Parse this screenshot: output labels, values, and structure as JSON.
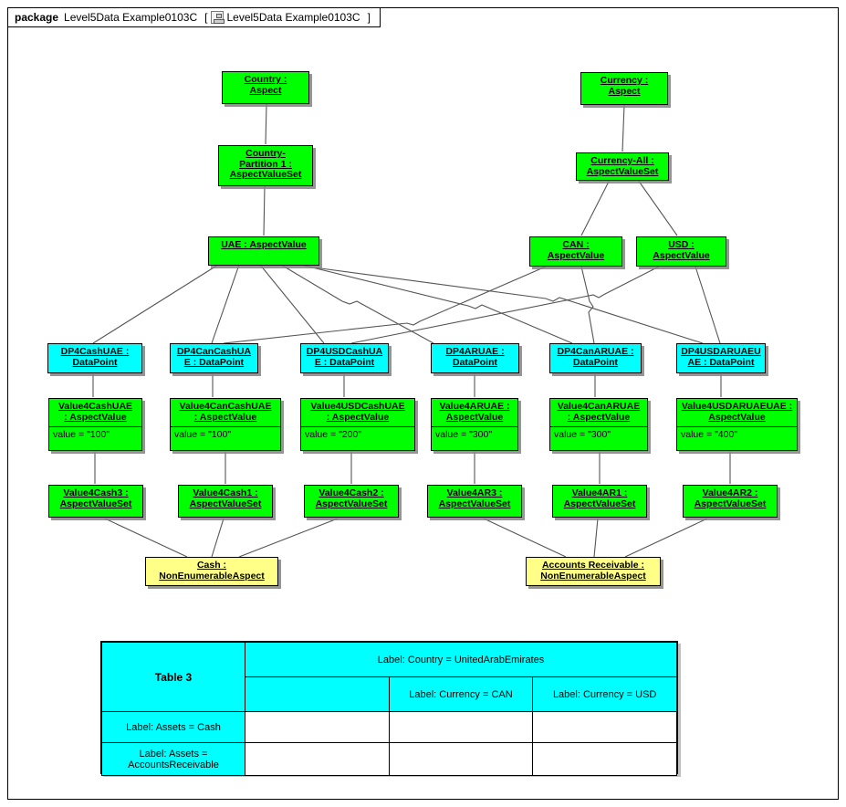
{
  "package": {
    "keyword": "package",
    "title": "Level5Data Example0103C",
    "bracket_open": "[",
    "icon": "class-diagram-icon",
    "diagram_name": "Level5Data Example0103C",
    "bracket_close": "]"
  },
  "colors": {
    "aspect_green": "#00FF00",
    "datapoint_cyan": "#00FFFF",
    "nonenumerable_yellow": "#FFFF88",
    "table_header_cyan": "#00FFFF",
    "border": "#000000",
    "edge": "#555555"
  },
  "nodes": [
    {
      "id": "country",
      "label": "Country :\nAspect",
      "kind": "green"
    },
    {
      "id": "currency",
      "label": "Currency :\nAspect",
      "kind": "green"
    },
    {
      "id": "countryPart1",
      "label": "Country-\nPartition 1 :\nAspectValueSet",
      "kind": "green"
    },
    {
      "id": "currencyAll",
      "label": "Currency-All :\nAspectValueSet",
      "kind": "green"
    },
    {
      "id": "uae",
      "label": "UAE : AspectValue",
      "kind": "green"
    },
    {
      "id": "can",
      "label": "CAN :\nAspectValue",
      "kind": "green"
    },
    {
      "id": "usd",
      "label": "USD :\nAspectValue",
      "kind": "green"
    },
    {
      "id": "dp4CashUAE",
      "label": "DP4CashUAE :\nDataPoint",
      "kind": "cyan"
    },
    {
      "id": "dp4CanCashUAE",
      "label": "DP4CanCashUA\nE : DataPoint",
      "kind": "cyan"
    },
    {
      "id": "dp4UsdCashUAE",
      "label": "DP4USDCashUA\nE : DataPoint",
      "kind": "cyan"
    },
    {
      "id": "dp4ARUAE",
      "label": "DP4ARUAE :\nDataPoint",
      "kind": "cyan"
    },
    {
      "id": "dp4CanARUAE",
      "label": "DP4CanARUAE :\nDataPoint",
      "kind": "cyan"
    },
    {
      "id": "dp4UsdARUAEUAE",
      "label": "DP4USDARUAEU\nAE : DataPoint",
      "kind": "cyan"
    },
    {
      "id": "v4CashUAE",
      "label": "Value4CashUAE\n: AspectValue",
      "kind": "green",
      "attr": "value = \"100\""
    },
    {
      "id": "v4CanCashUAE",
      "label": "Value4CanCashUAE\n: AspectValue",
      "kind": "green",
      "attr": "value = \"100\""
    },
    {
      "id": "v4UsdCashUAE",
      "label": "Value4USDCashUAE\n: AspectValue",
      "kind": "green",
      "attr": "value = \"200\""
    },
    {
      "id": "v4ARUAE",
      "label": "Value4ARUAE :\nAspectValue",
      "kind": "green",
      "attr": "value = \"300\""
    },
    {
      "id": "v4CanARUAE",
      "label": "Value4CanARUAE\n: AspectValue",
      "kind": "green",
      "attr": "value = \"300\""
    },
    {
      "id": "v4UsdARUAEUAE",
      "label": "Value4USDARUAEUAE :\nAspectValue",
      "kind": "green",
      "attr": "value = \"400\""
    },
    {
      "id": "v4Cash3",
      "label": "Value4Cash3 :\nAspectValueSet",
      "kind": "green"
    },
    {
      "id": "v4Cash1",
      "label": "Value4Cash1 :\nAspectValueSet",
      "kind": "green"
    },
    {
      "id": "v4Cash2",
      "label": "Value4Cash2 :\nAspectValueSet",
      "kind": "green"
    },
    {
      "id": "v4AR3",
      "label": "Value4AR3 :\nAspectValueSet",
      "kind": "green"
    },
    {
      "id": "v4AR1",
      "label": "Value4AR1 :\nAspectValueSet",
      "kind": "green"
    },
    {
      "id": "v4AR2",
      "label": "Value4AR2 :\nAspectValueSet",
      "kind": "green"
    },
    {
      "id": "cash",
      "label": "Cash :\nNonEnumerableAspect",
      "kind": "yellow"
    },
    {
      "id": "accountsRecv",
      "label": "Accounts Receivable :\nNonEnumerableAspect",
      "kind": "yellow"
    }
  ],
  "table3": {
    "corner_label": "Table 3",
    "country_header": "Label: Country = UnitedArabEmirates",
    "currency_headers": [
      "Label: Currency = CAN",
      "Label: Currency = USD"
    ],
    "row_labels": [
      "Label: Assets = Cash",
      "Label: Assets =\nAccountsReceivable"
    ],
    "body_cells": [
      [
        "",
        "",
        ""
      ],
      [
        "",
        "",
        ""
      ]
    ]
  }
}
